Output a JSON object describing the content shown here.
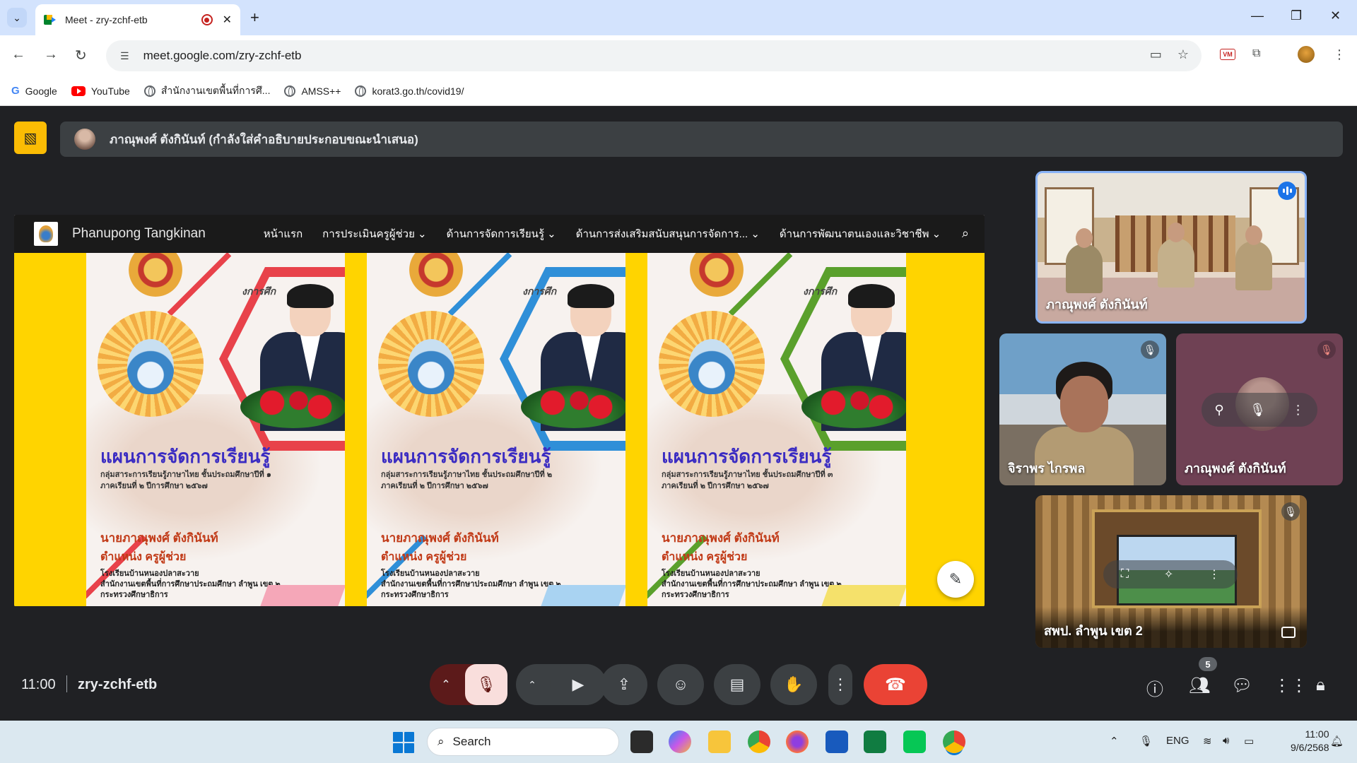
{
  "browser": {
    "tab_title": "Meet - zry-zchf-etb",
    "url": "meet.google.com/zry-zchf-etb",
    "bookmarks": [
      {
        "label": "Google",
        "icon": "google-icon"
      },
      {
        "label": "YouTube",
        "icon": "youtube-icon"
      },
      {
        "label": "สำนักงานเขตพื้นที่การศึ...",
        "icon": "globe-icon"
      },
      {
        "label": "AMSS++",
        "icon": "globe-icon"
      },
      {
        "label": "korat3.go.th/covid19/",
        "icon": "globe-icon"
      }
    ]
  },
  "meet": {
    "presenter_banner": "ภาณุพงศ์ ตังกินันท์ (กำลังใส่คำอธิบายประกอบขณะนำเสนอ)",
    "meeting_time": "11:00",
    "meeting_code": "zry-zchf-etb",
    "participant_count": "5",
    "presented_site": {
      "title": "Phanupong Tangkinan",
      "menu": [
        "หน้าแรก",
        "การประเมินครูผู้ช่วย ⌄",
        "ด้านการจัดการเรียนรู้ ⌄",
        "ด้านการส่งเสริมสนับสนุนการจัดการ... ⌄",
        "ด้านการพัฒนาตนเองและวิชาชีพ ⌄"
      ]
    },
    "posters": [
      {
        "tag": "งการศึก",
        "title": "แผนการจัดการเรียนรู้",
        "sub1": "กลุ่มสาระการเรียนรู้ภาษาไทย ชั้นประถมศึกษาปีที่ ๑",
        "sub2": "ภาคเรียนที่ ๒ ปีการศึกษา ๒๕๖๗",
        "name": "นายภาณุพงศ์ ตังกินันท์",
        "position": "ตำแหน่ง ครูผู้ช่วย",
        "line1": "โรงเรียนบ้านหนองปลาสะวาย",
        "line2": "สำนักงานเขตพื้นที่การศึกษาประถมศึกษา ลำพูน เขต ๒",
        "line3": "กระทรวงศึกษาธิการ",
        "accent": "#e8424a"
      },
      {
        "tag": "งการศึก",
        "title": "แผนการจัดการเรียนรู้",
        "sub1": "กลุ่มสาระการเรียนรู้ภาษาไทย ชั้นประถมศึกษาปีที่ ๒",
        "sub2": "ภาคเรียนที่ ๒ ปีการศึกษา ๒๕๖๗",
        "name": "นายภาณุพงศ์ ตังกินันท์",
        "position": "ตำแหน่ง ครูผู้ช่วย",
        "line1": "โรงเรียนบ้านหนองปลาสะวาย",
        "line2": "สำนักงานเขตพื้นที่การศึกษาประถมศึกษา ลำพูน เขต ๒",
        "line3": "กระทรวงศึกษาธิการ",
        "accent": "#2f8fd8"
      },
      {
        "tag": "งการศึก",
        "title": "แผนการจัดการเรียนรู้",
        "sub1": "กลุ่มสาระการเรียนรู้ภาษาไทย ชั้นประถมศึกษาปีที่ ๓",
        "sub2": "ภาคเรียนที่ ๒ ปีการศึกษา ๒๕๖๗",
        "name": "นายภาณุพงศ์ ตังกินันท์",
        "position": "ตำแหน่ง ครูผู้ช่วย",
        "line1": "โรงเรียนบ้านหนองปลาสะวาย",
        "line2": "สำนักงานเขตพื้นที่การศึกษาประถมศึกษา ลำพูน เขต ๒",
        "line3": "กระทรวงศึกษาธิการ",
        "accent": "#5aa02c"
      }
    ],
    "participants": [
      {
        "name": "ภาณุพงศ์ ตังกินันท์",
        "state": "speaking"
      },
      {
        "name": "จิราพร ไกรพล",
        "state": "muted"
      },
      {
        "name": "ภาณุพงศ์ ตังกินันท์",
        "state": "muted"
      },
      {
        "name": "สพป. ลำพูน เขต 2",
        "state": "muted"
      }
    ]
  },
  "taskbar": {
    "search_placeholder": "Search",
    "language": "ENG",
    "time": "11:00",
    "date": "9/6/2568"
  },
  "colors": {
    "meet_bg": "#202124",
    "leave_red": "#ea4335",
    "present_yellow": "#fbbc04",
    "mic_off_bg": "#f9dedc"
  }
}
